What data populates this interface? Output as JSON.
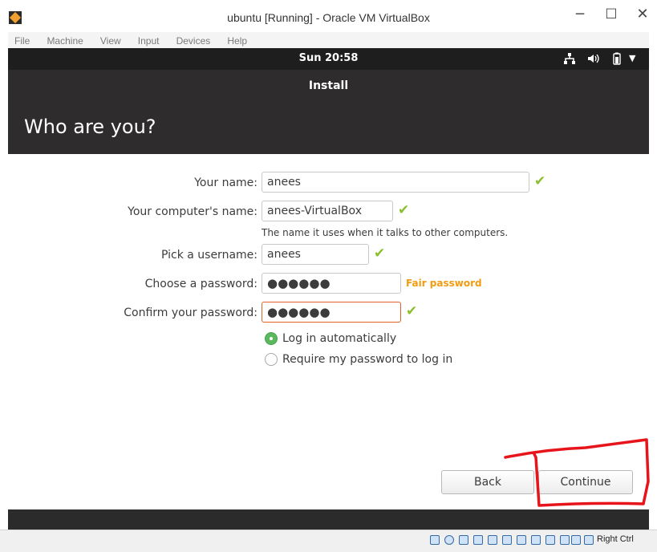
{
  "window": {
    "title": "ubuntu [Running] - Oracle VM VirtualBox",
    "controls": {
      "minimize": "─",
      "maximize": "☐",
      "close": "✕"
    }
  },
  "menubar": {
    "items": [
      "File",
      "Machine",
      "View",
      "Input",
      "Devices",
      "Help"
    ]
  },
  "guest": {
    "topbar": {
      "clock": "Sun 20:58",
      "icons": {
        "network": "network-icon",
        "volume": "volume-icon",
        "battery": "battery-icon",
        "menu": "menu-arrow-icon"
      }
    },
    "installer": {
      "title": "Install",
      "page_title": "Who are you?",
      "fields": {
        "name": {
          "label": "Your name:",
          "value": "anees"
        },
        "computer": {
          "label": "Your computer's name:",
          "value": "anees-VirtualBox",
          "hint": "The name it uses when it talks to other computers."
        },
        "username": {
          "label": "Pick a username:",
          "value": "anees"
        },
        "password": {
          "label": "Choose a password:",
          "value": "●●●●●●",
          "strength": "Fair password"
        },
        "confirm": {
          "label": "Confirm your password:",
          "value": "●●●●●●"
        }
      },
      "login_options": {
        "auto": {
          "label": "Log in automatically",
          "selected": true
        },
        "password": {
          "label": "Require my password to log in",
          "selected": false
        }
      },
      "buttons": {
        "back": "Back",
        "continue": "Continue"
      }
    }
  },
  "statusbar": {
    "host_key": "Right Ctrl"
  },
  "colors": {
    "accent_check": "#8bbf2e",
    "strength_warning": "#f39c12",
    "radio_selected": "#5cb85c",
    "annotation": "#e8141b"
  }
}
